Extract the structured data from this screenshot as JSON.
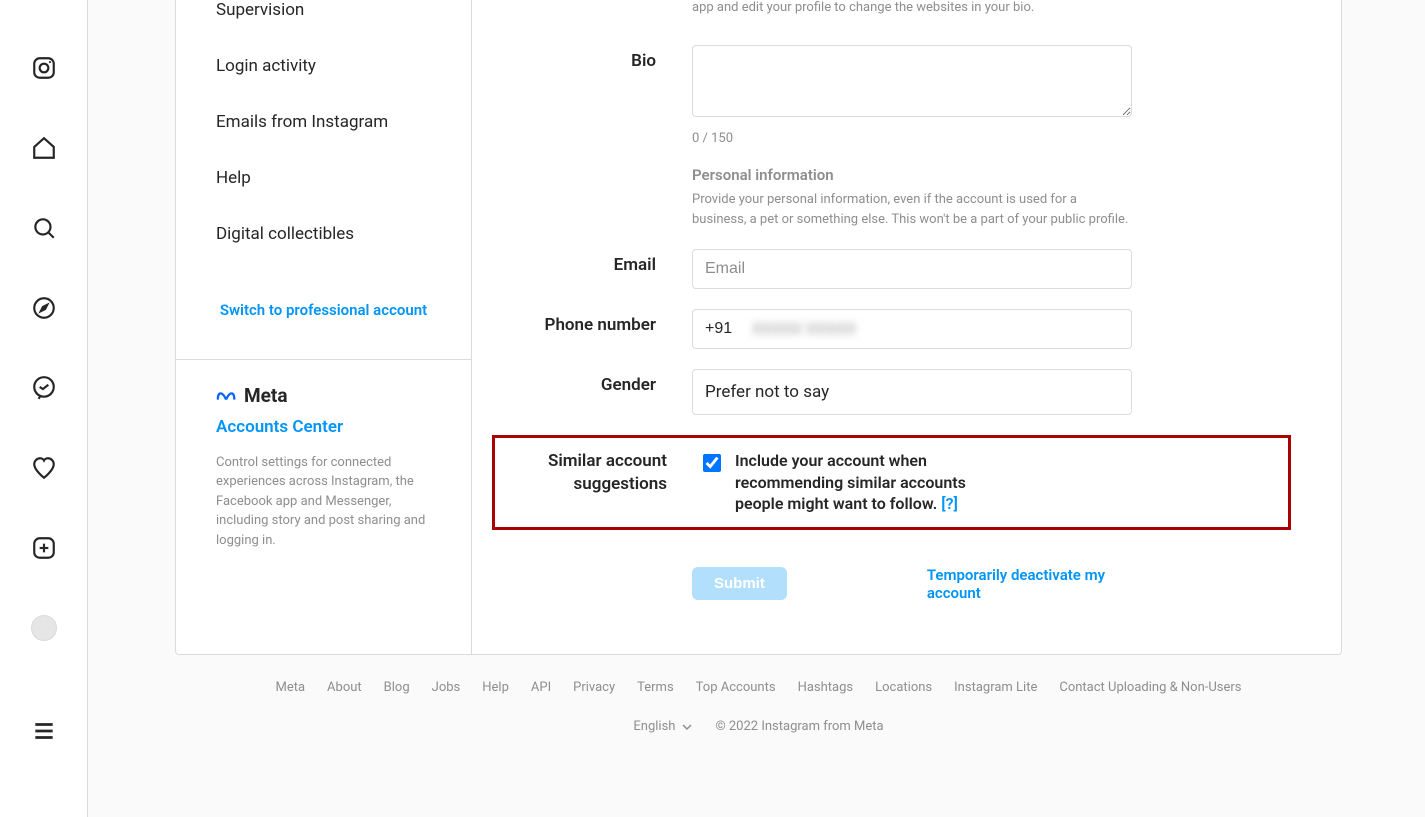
{
  "sidebar": {
    "items": [
      {
        "label": "Supervision"
      },
      {
        "label": "Login activity"
      },
      {
        "label": "Emails from Instagram"
      },
      {
        "label": "Help"
      },
      {
        "label": "Digital collectibles"
      }
    ],
    "switch_pro": "Switch to professional account"
  },
  "meta": {
    "brand": "Meta",
    "accounts_center": "Accounts Center",
    "desc": "Control settings for connected experiences across Instagram, the Facebook app and Messenger, including story and post sharing and logging in."
  },
  "form": {
    "website_hint_truncated": "app and edit your profile to change the websites in your bio.",
    "bio_label": "Bio",
    "bio_value": "",
    "char_count": "0 / 150",
    "personal_info_title": "Personal information",
    "personal_info_desc": "Provide your personal information, even if the account is used for a business, a pet or something else. This won't be a part of your public profile.",
    "email_label": "Email",
    "email_placeholder": "Email",
    "email_value": "",
    "phone_label": "Phone number",
    "phone_value": "+91 ",
    "phone_blurred": "XXXXX XXXXX",
    "gender_label": "Gender",
    "gender_value": "Prefer not to say",
    "similar_label1": "Similar account",
    "similar_label2": "suggestions",
    "similar_desc": "Include your account when recommending similar accounts people might want to follow.",
    "similar_help": "[?]",
    "similar_checked": true,
    "submit": "Submit",
    "deactivate": "Temporarily deactivate my account"
  },
  "footer": {
    "links": [
      "Meta",
      "About",
      "Blog",
      "Jobs",
      "Help",
      "API",
      "Privacy",
      "Terms",
      "Top Accounts",
      "Hashtags",
      "Locations",
      "Instagram Lite",
      "Contact Uploading & Non-Users"
    ],
    "language": "English",
    "copyright": "© 2022 Instagram from Meta"
  }
}
